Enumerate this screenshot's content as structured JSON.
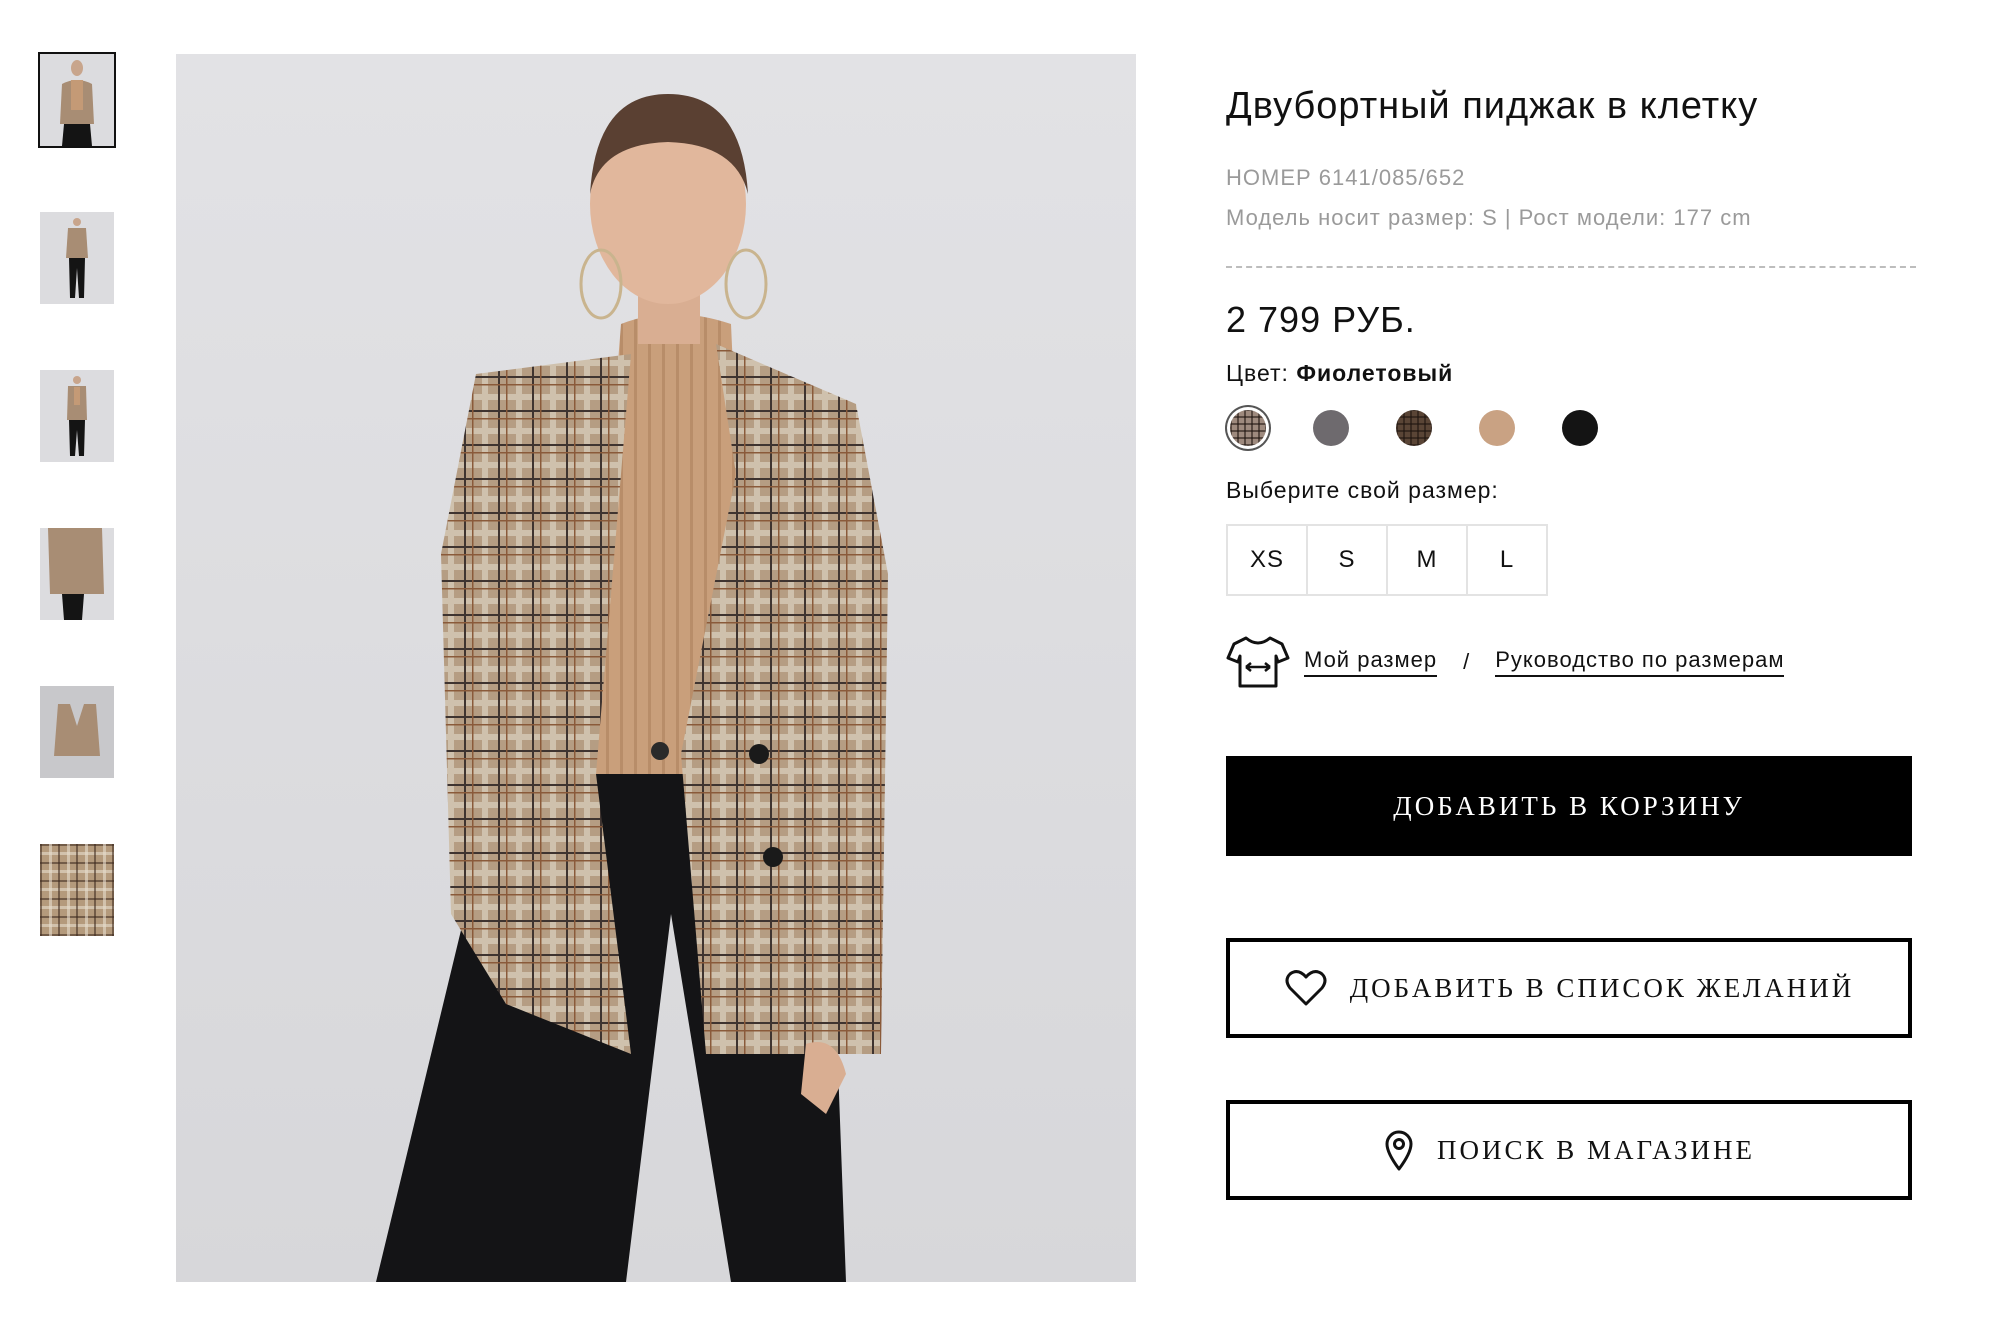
{
  "product": {
    "title": "Двубортный пиджак в клетку",
    "number": "НОМЕР 6141/085/652",
    "model_info": "Модель носит размер: S | Рост модели: 177 cm",
    "price": "2 799 РУБ."
  },
  "color": {
    "label": "Цвет: ",
    "value": "Фиолетовый",
    "swatches": [
      {
        "name": "plaid-beige",
        "color": "#9e8a7e",
        "selected": true
      },
      {
        "name": "grey",
        "color": "#6e6a6e",
        "selected": false
      },
      {
        "name": "plaid-brown",
        "color": "#5a4536",
        "selected": false
      },
      {
        "name": "camel",
        "color": "#c9a283",
        "selected": false
      },
      {
        "name": "black",
        "color": "#141414",
        "selected": false
      }
    ]
  },
  "size": {
    "label": "Выберите свой размер:",
    "options": [
      "XS",
      "S",
      "M",
      "L"
    ],
    "my_size_link": "Мой размер",
    "separator": "/",
    "guide_link": "Руководство по размерам"
  },
  "actions": {
    "add_to_cart": "ДОБАВИТЬ В КОРЗИНУ",
    "add_to_wishlist": "ДОБАВИТЬ В СПИСОК ЖЕЛАНИЙ",
    "find_in_store": "ПОИСК В МАГАЗИНЕ"
  },
  "gallery": {
    "thumbnails": [
      "model-front-closeup",
      "model-full-front",
      "model-full-front-2",
      "model-side",
      "jacket-flat",
      "fabric-detail"
    ],
    "selected_index": 0
  }
}
